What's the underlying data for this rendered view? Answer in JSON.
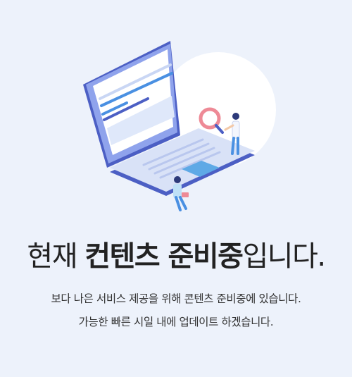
{
  "title": {
    "part1": "현재 ",
    "bold": "컨텐츠 준비중",
    "part2": "입니다."
  },
  "description": {
    "line1": "보다 나은 서비스 제공을 위해 콘텐츠 준비중에 있습니다.",
    "line2": "가능한 빠른 시일 내에 업데이트 하겠습니다."
  },
  "colors": {
    "background": "#edf2fb",
    "accent": "#4a90e2",
    "laptop_frame": "#7b8fe0",
    "magnifier": "#ee8a96"
  },
  "illustration": {
    "icon": "laptop-illustration"
  }
}
